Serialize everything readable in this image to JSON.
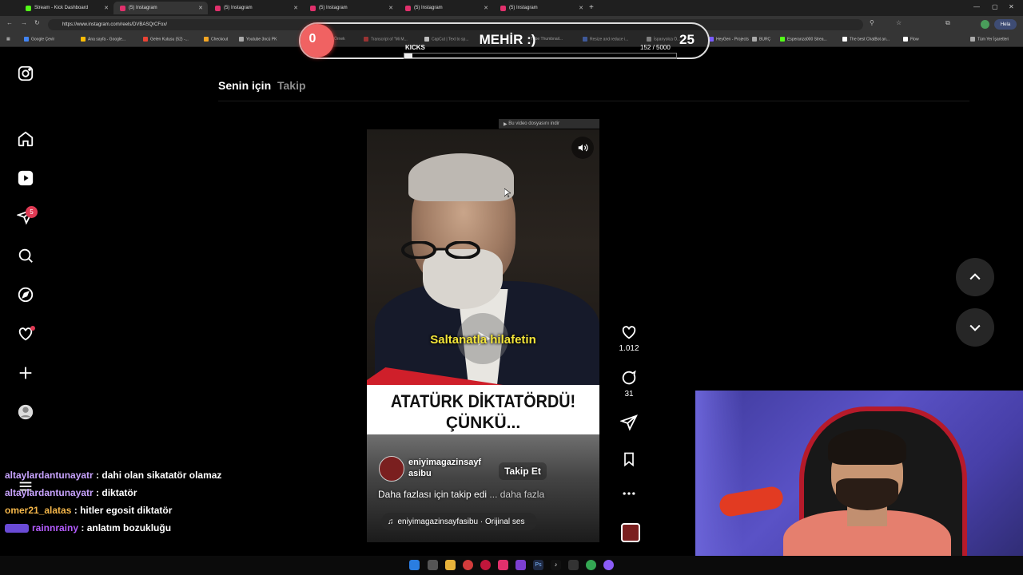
{
  "browser": {
    "tabs": [
      {
        "label": "Stream - Kick Dashboard",
        "color": "#53fc18"
      },
      {
        "label": "(5) Instagram",
        "color": "#e1306c",
        "active": true
      },
      {
        "label": "(5) Instagram",
        "color": "#e1306c"
      },
      {
        "label": "(5) Instagram",
        "color": "#e1306c"
      },
      {
        "label": "(5) Instagram",
        "color": "#e1306c"
      },
      {
        "label": "(5) Instagram",
        "color": "#e1306c"
      }
    ],
    "new_tab": "+",
    "url": "https://www.instagram.com/reels/DVBASQrCFox/",
    "profile_label": "Hela",
    "bookmarks": [
      {
        "label": "Google Çevir",
        "color": "#4285f4"
      },
      {
        "label": "Ana sayfa - Google...",
        "color": "#fbbc05"
      },
      {
        "label": "Gelen Kutusu (52) -...",
        "color": "#ea4335"
      },
      {
        "label": "Checkout",
        "color": "#f5a623"
      },
      {
        "label": "Youtube 3ncü PK",
        "color": "#aaaaaa"
      },
      {
        "label": "Örnek",
        "color": "#888888"
      },
      {
        "label": "Transcript of \"Mi M...",
        "color": "#cc4444"
      },
      {
        "label": "CapCut | Text to sp...",
        "color": "#ffffff"
      },
      {
        "label": "Tube Thumbnail...",
        "color": "#cc0000"
      },
      {
        "label": "Resize and reduce i...",
        "color": "#5577cc"
      },
      {
        "label": "İspanyolca Ö...",
        "color": "#aaaaaa"
      },
      {
        "label": "HeyGen - Projects",
        "color": "#7a5cff"
      },
      {
        "label": "BURÇ",
        "color": "#aaaaaa"
      },
      {
        "label": "Esperanza000 Strea...",
        "color": "#53fc18"
      },
      {
        "label": "The best ChatBot an...",
        "color": "#ffffff"
      },
      {
        "label": "Flow",
        "color": "#ffffff"
      }
    ],
    "all_bookmarks": "Tüm Yer İşaretleri"
  },
  "goal_overlay": {
    "left_value": "0",
    "title": "MEHİR :)",
    "right_value": "25",
    "kicks_label": "KICKS",
    "count_text": "152 / 5000",
    "progress": 0.0304
  },
  "sidebar": {
    "notification_count": "5"
  },
  "feed_tabs": {
    "for_you": "Senin için",
    "following": "Takip"
  },
  "download_bar": "Bu video dosyasını indir",
  "reel": {
    "subtitle": "Saltanatla hilafetin",
    "headline_line1": "ATATÜRK DİKTATÖRDÜ!",
    "headline_line2": "ÇÜNKÜ...",
    "username_line1": "eniyimagazinsayf",
    "username_line2": "asibu",
    "follow_label": "Takip Et",
    "caption": "Daha fazlası için takip edi",
    "caption_more": "... daha fazla",
    "audio": "eniyimagazinsayfasibu · Orijinal ses"
  },
  "actions": {
    "likes": "1.012",
    "comments": "31"
  },
  "chat": [
    {
      "user": "altaylardantunayatr",
      "message": "dahi olan sikatatör olamaz",
      "color": "#c9a4ff"
    },
    {
      "user": "altaylardantunayatr",
      "message": "diktatör",
      "color": "#c9a4ff"
    },
    {
      "user": "omer21_alatas",
      "message": "hitler egosit diktatör",
      "color": "#f5b74a"
    },
    {
      "user": "rainnrainy",
      "message": "anlatım bozukluğu",
      "color": "#b45cff"
    }
  ],
  "colors": {
    "instagram_bg": "#000000",
    "badge_red": "#e03a54",
    "subtitle_yellow": "#f4e63a",
    "goal_circle": "#f06262"
  }
}
